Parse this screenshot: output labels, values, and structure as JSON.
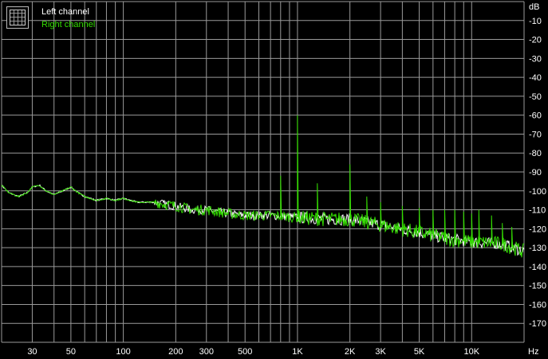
{
  "legend": {
    "left_label": "Left channel",
    "right_label": "Right channel"
  },
  "colors": {
    "background": "#000000",
    "grid": "#9a9a9a",
    "left_channel": "#ffffff",
    "right_channel": "#33dd00",
    "text": "#ffffff"
  },
  "chart_data": {
    "type": "line",
    "x_scale": "log",
    "y_unit_label": "dB",
    "x_unit_label": "Hz",
    "xlim": [
      20,
      20000
    ],
    "ylim": [
      -180,
      0
    ],
    "grid": true,
    "legend_position": "top-left",
    "y_tick_labels": [
      "-10",
      "-20",
      "-30",
      "-40",
      "-50",
      "-60",
      "-70",
      "-80",
      "-90",
      "-100",
      "-110",
      "-120",
      "-130",
      "-140",
      "-150",
      "-160",
      "-170"
    ],
    "x_tick_labels": [
      "30",
      "50",
      "100",
      "200",
      "300",
      "500",
      "1K",
      "2K",
      "3K",
      "5K",
      "10K"
    ],
    "series": [
      {
        "name": "Left channel",
        "x": [
          20,
          22,
          25,
          28,
          30,
          33,
          36,
          40,
          45,
          50,
          55,
          60,
          70,
          80,
          90,
          100,
          120,
          150,
          200,
          250,
          300,
          400,
          500,
          700,
          1000,
          1500,
          2000,
          3000,
          5000,
          7000,
          10000,
          15000,
          20000
        ],
        "y": [
          -97,
          -101,
          -103,
          -101,
          -98,
          -97,
          -100,
          -102,
          -100,
          -98,
          -101,
          -103,
          -105,
          -104,
          -105,
          -104,
          -106,
          -106,
          -108,
          -110,
          -110,
          -112,
          -113,
          -113,
          -114,
          -115,
          -115,
          -118,
          -122,
          -125,
          -127,
          -128,
          -132
        ]
      },
      {
        "name": "Right channel",
        "x": [
          20,
          22,
          25,
          28,
          30,
          33,
          36,
          40,
          45,
          50,
          55,
          60,
          70,
          80,
          90,
          100,
          120,
          150,
          200,
          250,
          300,
          400,
          500,
          700,
          1000,
          1500,
          2000,
          3000,
          5000,
          7000,
          10000,
          15000,
          20000
        ],
        "y": [
          -97,
          -101,
          -103,
          -101,
          -98,
          -97,
          -100,
          -102,
          -100,
          -98,
          -101,
          -103,
          -105,
          -104,
          -105,
          -104,
          -106,
          -106,
          -108,
          -110,
          -110,
          -112,
          -113,
          -113,
          -114,
          -115,
          -115,
          -118,
          -122,
          -125,
          -127,
          -128,
          -132
        ],
        "spurs": [
          {
            "x": 800,
            "y": -92
          },
          {
            "x": 1000,
            "y": -60
          },
          {
            "x": 1300,
            "y": -96
          },
          {
            "x": 2000,
            "y": -86
          },
          {
            "x": 2500,
            "y": -103
          },
          {
            "x": 3000,
            "y": -106
          },
          {
            "x": 4000,
            "y": -108
          },
          {
            "x": 5000,
            "y": -109
          },
          {
            "x": 6000,
            "y": -110
          },
          {
            "x": 7000,
            "y": -110
          },
          {
            "x": 8000,
            "y": -110
          },
          {
            "x": 9000,
            "y": -111
          },
          {
            "x": 10000,
            "y": -112
          },
          {
            "x": 11000,
            "y": -110
          },
          {
            "x": 13000,
            "y": -113
          },
          {
            "x": 15000,
            "y": -117
          },
          {
            "x": 17000,
            "y": -119
          }
        ]
      }
    ]
  }
}
